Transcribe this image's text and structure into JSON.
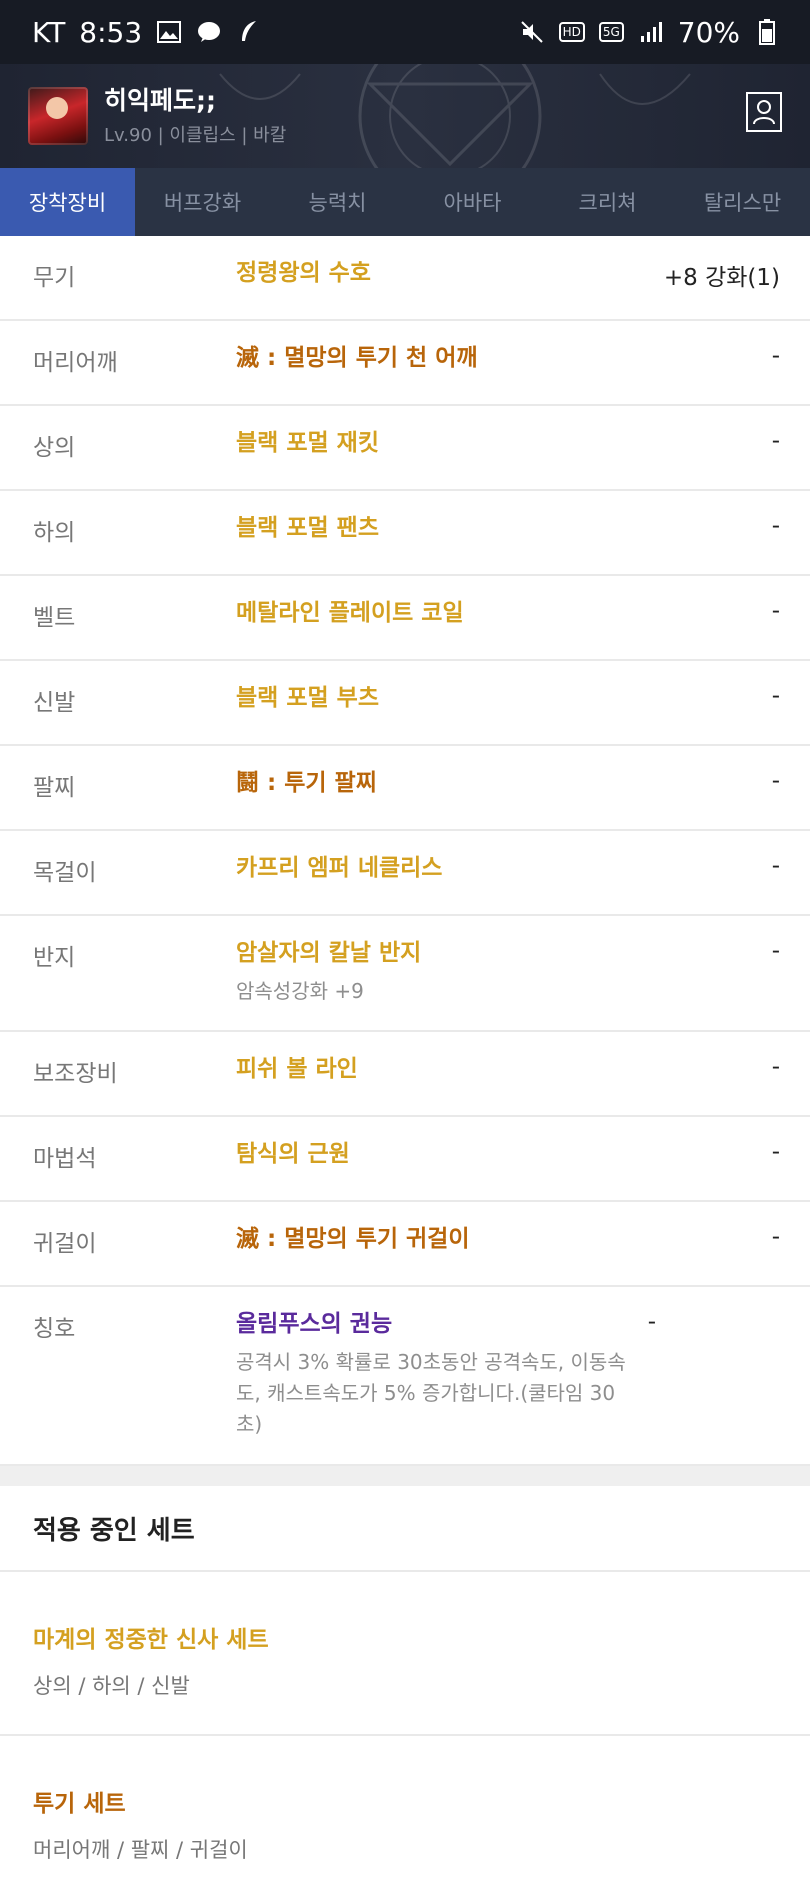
{
  "status_bar": {
    "carrier": "KT",
    "time": "8:53",
    "network": "5G",
    "hd": "HD",
    "battery": "70%",
    "icons": [
      "image-icon",
      "chat-bubble-icon",
      "feather-icon",
      "mute-icon",
      "signal-icon",
      "battery-icon"
    ]
  },
  "header": {
    "name": "히익페도;;",
    "meta": "Lv.90 | 이클립스 | 바칼"
  },
  "tabs": [
    "장착장비",
    "버프강화",
    "능력치",
    "아바타",
    "크리쳐",
    "탈리스만"
  ],
  "colors": {
    "gold": "#d4a020",
    "orange": "#b8650a",
    "purple": "#5a2a9c",
    "tab_active": "#3a5ab0"
  },
  "equipment": [
    {
      "slot": "무기",
      "name": "정령왕의 수호",
      "color": "gold",
      "enhance": "+8 강화(1)"
    },
    {
      "slot": "머리어깨",
      "name": "滅 : 멸망의 투기 천 어깨",
      "color": "orange",
      "enhance": "-"
    },
    {
      "slot": "상의",
      "name": "블랙 포멀 재킷",
      "color": "gold",
      "enhance": "-"
    },
    {
      "slot": "하의",
      "name": "블랙 포멀 팬츠",
      "color": "gold",
      "enhance": "-"
    },
    {
      "slot": "벨트",
      "name": "메탈라인 플레이트 코일",
      "color": "gold",
      "enhance": "-"
    },
    {
      "slot": "신발",
      "name": "블랙 포멀 부츠",
      "color": "gold",
      "enhance": "-"
    },
    {
      "slot": "팔찌",
      "name": "鬪 : 투기 팔찌",
      "color": "orange",
      "enhance": "-"
    },
    {
      "slot": "목걸이",
      "name": "카프리 엠퍼 네클리스",
      "color": "gold",
      "enhance": "-"
    },
    {
      "slot": "반지",
      "name": "암살자의 칼날 반지",
      "color": "gold",
      "enhance": "-",
      "sub": "암속성강화 +9"
    },
    {
      "slot": "보조장비",
      "name": "피쉬 볼 라인",
      "color": "gold",
      "enhance": "-"
    },
    {
      "slot": "마법석",
      "name": "탐식의 근원",
      "color": "gold",
      "enhance": "-"
    },
    {
      "slot": "귀걸이",
      "name": "滅 : 멸망의 투기 귀걸이",
      "color": "orange",
      "enhance": "-"
    },
    {
      "slot": "칭호",
      "name": "올림푸스의 권능",
      "color": "purple",
      "enhance": "-",
      "sub": "공격시 3% 확률로 30초동안 공격속도, 이동속도, 캐스트속도가 5% 증가합니다.(쿨타임 30초)"
    }
  ],
  "sets": {
    "title": "적용 중인 세트",
    "items": [
      {
        "name": "마계의 정중한 신사 세트",
        "color": "gold",
        "parts": "상의 / 하의 / 신발"
      },
      {
        "name": "투기 세트",
        "color": "orange",
        "parts": "머리어깨 / 팔찌 / 귀걸이"
      }
    ]
  }
}
